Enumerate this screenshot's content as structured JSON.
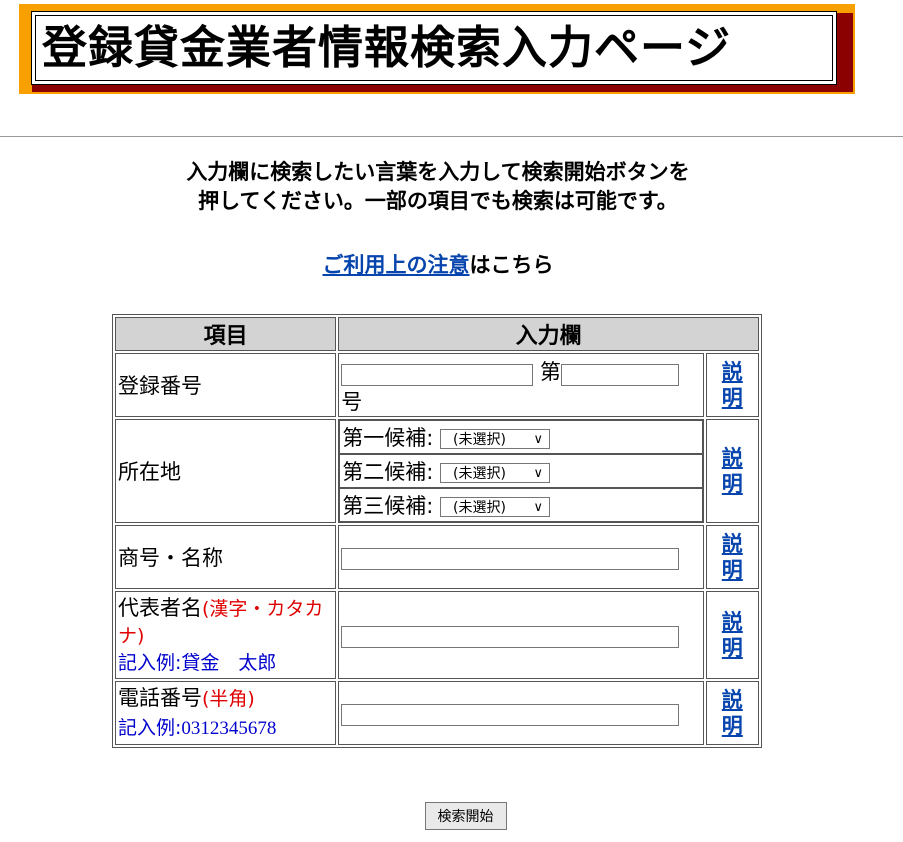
{
  "page_title": "登録貸金業者情報検索入力ページ",
  "intro": {
    "line1": "入力欄に検索したい言葉を入力して検索開始ボタンを",
    "line2": "押してください。一部の項目でも検索は可能です。"
  },
  "notice": {
    "link": "ご利用上の注意",
    "suffix": "はこちら"
  },
  "table": {
    "header_item": "項目",
    "header_input": "入力欄",
    "help_label": "説明",
    "rows": {
      "registration": {
        "label": "登録番号",
        "dai": "第",
        "go": "号"
      },
      "location": {
        "label": "所在地",
        "candidates": [
          "第一候補:",
          "第二候補:",
          "第三候補:"
        ],
        "selected": "(未選択)"
      },
      "trade_name": {
        "label": "商号・名称"
      },
      "representative": {
        "label": "代表者名",
        "note": "(漢字・カタカナ)",
        "example": "記入例:貸金　太郎"
      },
      "phone": {
        "label": "電話番号",
        "note": "(半角)",
        "example_prefix": "記入例:",
        "example_value": "0312345678"
      }
    }
  },
  "submit_label": "検索開始",
  "colors": {
    "banner_orange": "#f8a000",
    "banner_shadow": "#8b0000",
    "link": "#0645ad",
    "note_red": "#e00000",
    "example_blue": "#0000cc"
  }
}
